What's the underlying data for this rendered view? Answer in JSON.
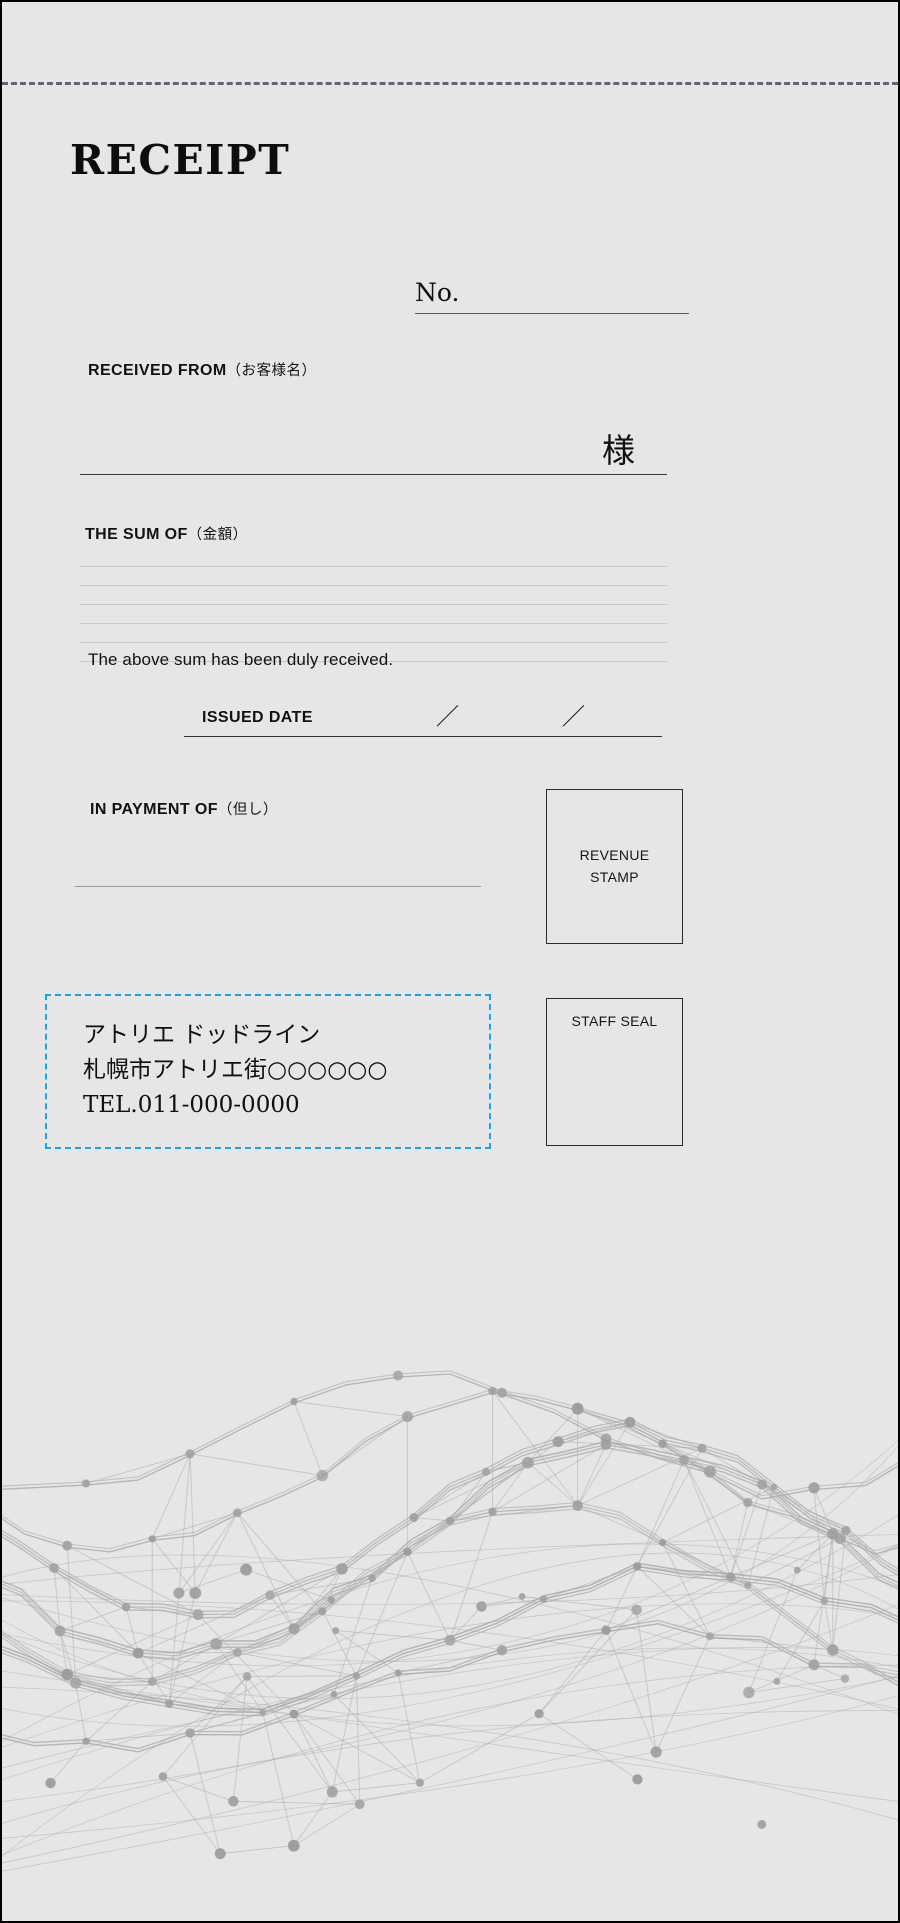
{
  "document": {
    "title": "RECEIPT",
    "background_color": "#e6e6e6",
    "border_color": "#000000"
  },
  "tear_line": {
    "color": "#6d5f73",
    "style": "dashed"
  },
  "number_field": {
    "label": "No.",
    "value": ""
  },
  "received_from": {
    "label_en": "RECEIVED FROM",
    "label_jp": "（お客様名）",
    "honorific": "様",
    "value": ""
  },
  "sum_of": {
    "label_en": "THE SUM OF",
    "label_jp": "（金額）",
    "rule_count": 6,
    "value": ""
  },
  "statement": {
    "text": "The above sum has been duly received."
  },
  "issued_date": {
    "label": "ISSUED DATE",
    "separator_1": "／",
    "separator_2": "／",
    "year": "",
    "month": "",
    "day": ""
  },
  "in_payment_of": {
    "label_en": "IN PAYMENT OF",
    "label_jp": "（但し）",
    "value": ""
  },
  "revenue_stamp": {
    "line_1": "REVENUE",
    "line_2": "STAMP"
  },
  "staff_seal": {
    "label": "STAFF SEAL"
  },
  "company": {
    "border_color": "#1aa3e8",
    "name": "アトリエ ドッドライン",
    "address": "札幌市アトリエ街○○○○○○",
    "telephone": "TEL.011-000-0000"
  },
  "decoration": {
    "name": "network-mesh-graphic",
    "node_color": "#9e9e9e",
    "line_color": "#a8a8a8"
  }
}
